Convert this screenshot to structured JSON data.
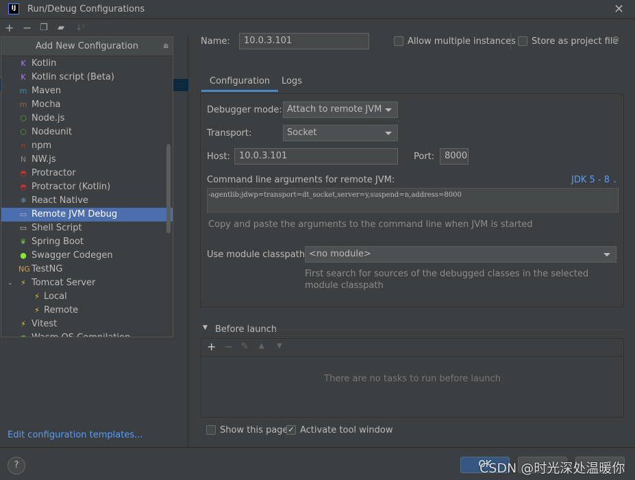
{
  "window": {
    "title": "Run/Debug Configurations",
    "logo": "IJ"
  },
  "toolbar": {
    "icons": [
      "plus-icon",
      "minus-icon",
      "copy-icon",
      "folder-add-icon",
      "sort-icon"
    ]
  },
  "popup": {
    "title": "Add New Configuration",
    "items": [
      {
        "label": "Kotlin",
        "icon": "kotlin-icon",
        "color": "#a97bff",
        "glyph": "K"
      },
      {
        "label": "Kotlin script (Beta)",
        "icon": "kotlin-icon",
        "color": "#a97bff",
        "glyph": "K"
      },
      {
        "label": "Maven",
        "icon": "maven-icon",
        "color": "#3d8fb8",
        "glyph": "m"
      },
      {
        "label": "Mocha",
        "icon": "mocha-icon",
        "color": "#8d6748",
        "glyph": "m"
      },
      {
        "label": "Node.js",
        "icon": "nodejs-icon",
        "color": "#5a9e4b",
        "glyph": "⬡"
      },
      {
        "label": "Nodeunit",
        "icon": "nodeunit-icon",
        "color": "#5a9e4b",
        "glyph": "⬡"
      },
      {
        "label": "npm",
        "icon": "npm-icon",
        "color": "#c9302c",
        "glyph": "n"
      },
      {
        "label": "NW.js",
        "icon": "nwjs-icon",
        "color": "#888888",
        "glyph": "N"
      },
      {
        "label": "Protractor",
        "icon": "protractor-icon",
        "color": "#d0312d",
        "glyph": "◓"
      },
      {
        "label": "Protractor (Kotlin)",
        "icon": "protractor-icon",
        "color": "#d0312d",
        "glyph": "◓"
      },
      {
        "label": "React Native",
        "icon": "react-icon",
        "color": "#61dafb",
        "glyph": "⚛"
      },
      {
        "label": "Remote JVM Debug",
        "icon": "remote-debug-icon",
        "color": "#bbbbbb",
        "glyph": "▭",
        "selected": true
      },
      {
        "label": "Shell Script",
        "icon": "shell-icon",
        "color": "#bbbbbb",
        "glyph": "▭"
      },
      {
        "label": "Spring Boot",
        "icon": "spring-icon",
        "color": "#6db33f",
        "glyph": "❦"
      },
      {
        "label": "Swagger Codegen",
        "icon": "swagger-icon",
        "color": "#85ea2d",
        "glyph": "●"
      },
      {
        "label": "TestNG",
        "icon": "testng-icon",
        "color": "#c8a060",
        "glyph": "NG"
      },
      {
        "label": "Tomcat Server",
        "icon": "tomcat-icon",
        "color": "#f0c040",
        "glyph": "⚡",
        "expanded": true
      },
      {
        "label": "Local",
        "icon": "tomcat-icon",
        "color": "#f0c040",
        "glyph": "⚡",
        "sub": true
      },
      {
        "label": "Remote",
        "icon": "tomcat-icon",
        "color": "#f0c040",
        "glyph": "⚡",
        "sub": true
      },
      {
        "label": "Vitest",
        "icon": "vitest-icon",
        "color": "#fcc72b",
        "glyph": "⚡"
      },
      {
        "label": "Wasm OS Compilation",
        "icon": "wasm-icon",
        "color": "#5a9e4b",
        "glyph": "●"
      }
    ]
  },
  "left": {
    "edit_templates": "Edit configuration templates..."
  },
  "form": {
    "name_label": "Name:",
    "name_value": "10.0.3.101",
    "allow_multiple": "Allow multiple instances",
    "store_project": "Store as project file",
    "tabs": [
      "Configuration",
      "Logs"
    ],
    "debugger_mode_label": "Debugger mode:",
    "debugger_mode_value": "Attach to remote JVM",
    "transport_label": "Transport:",
    "transport_value": "Socket",
    "host_label": "Host:",
    "host_value": "10.0.3.101",
    "port_label": "Port:",
    "port_value": "8000",
    "cmd_label": "Command line arguments for remote JVM:",
    "jdk_link": "JDK 5 - 8",
    "cmd_value": "-agentlib:jdwp=transport=dt_socket,server=y,suspend=n,address=8000",
    "cmd_hint": "Copy and paste the arguments to the command line when JVM is started",
    "module_label": "Use module classpath:",
    "module_value": "<no module>",
    "module_hint_1": "First search for sources of the debugged classes in the selected",
    "module_hint_2": "module classpath"
  },
  "before_launch": {
    "title": "Before launch",
    "empty": "There are no tasks to run before launch"
  },
  "options": {
    "show_page": "Show this page",
    "show_page_checked": false,
    "activate_tool": "Activate tool window",
    "activate_tool_checked": true
  },
  "footer": {
    "help": "?",
    "ok": "OK",
    "watermark": "CSDN @时光深处温暖你"
  }
}
